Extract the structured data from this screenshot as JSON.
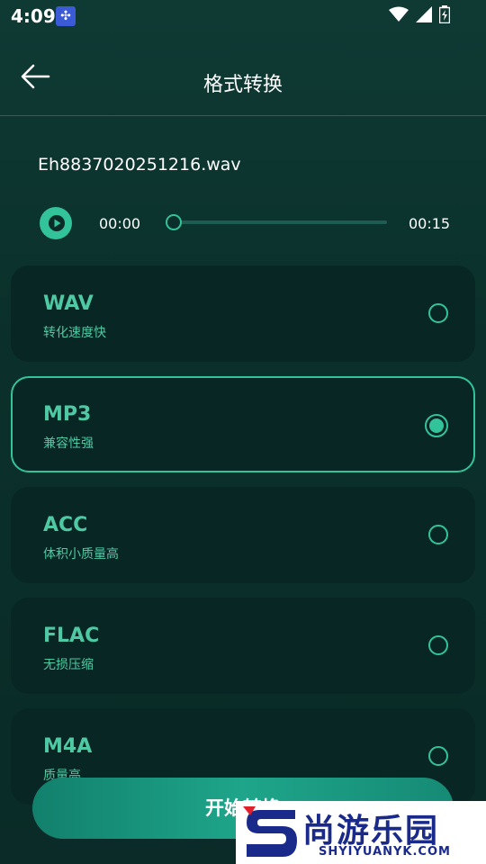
{
  "status_bar": {
    "time": "4:09"
  },
  "header": {
    "title": "格式转换"
  },
  "file": {
    "name": "Eh8837020251216.wav"
  },
  "player": {
    "current_time": "00:00",
    "total_time": "00:15",
    "progress": 0
  },
  "formats": [
    {
      "name": "WAV",
      "desc": "转化速度快",
      "selected": false
    },
    {
      "name": "MP3",
      "desc": "兼容性强",
      "selected": true
    },
    {
      "name": "ACC",
      "desc": "体积小质量高",
      "selected": false
    },
    {
      "name": "FLAC",
      "desc": "无损压缩",
      "selected": false
    },
    {
      "name": "M4A",
      "desc": "质量高",
      "selected": false
    }
  ],
  "start_button": {
    "label": "开始转换"
  },
  "watermark": {
    "text": "尚游乐园",
    "sub": "SHYIYUANYK.COM"
  },
  "colors": {
    "accent": "#33c39a",
    "card_bg": "#082724",
    "text_accent": "#4ec9a4"
  }
}
